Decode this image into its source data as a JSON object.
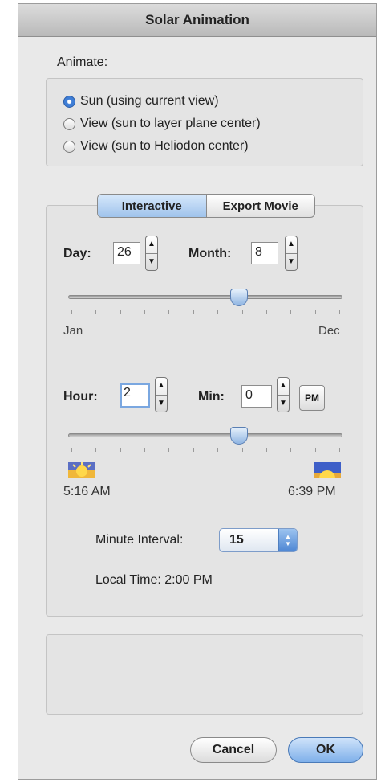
{
  "window": {
    "title": "Solar Animation"
  },
  "animate": {
    "label": "Animate:",
    "options": [
      {
        "label": "Sun (using current view)",
        "selected": true
      },
      {
        "label": "View (sun to layer plane center)",
        "selected": false
      },
      {
        "label": "View (sun to Heliodon center)",
        "selected": false
      }
    ]
  },
  "tabs": {
    "interactive": "Interactive",
    "export_movie": "Export Movie",
    "active": "Interactive"
  },
  "date": {
    "day_label": "Day:",
    "day_value": "26",
    "month_label": "Month:",
    "month_value": "8",
    "slider_min_label": "Jan",
    "slider_max_label": "Dec",
    "slider_fraction": 0.63
  },
  "time": {
    "hour_label": "Hour:",
    "hour_value": "2",
    "min_label": "Min:",
    "min_value": "0",
    "ampm_button": "PM",
    "sunrise": "5:16 AM",
    "sunset": "6:39 PM",
    "slider_fraction": 0.63,
    "sunrise_icon": "sunrise-icon",
    "sunset_icon": "sunset-icon"
  },
  "minute_interval": {
    "label": "Minute Interval:",
    "value": "15"
  },
  "local_time": "Local Time: 2:00 PM",
  "buttons": {
    "cancel": "Cancel",
    "ok": "OK"
  },
  "colors": {
    "accent": "#3f7ed6",
    "focus": "#7aa7e0"
  }
}
